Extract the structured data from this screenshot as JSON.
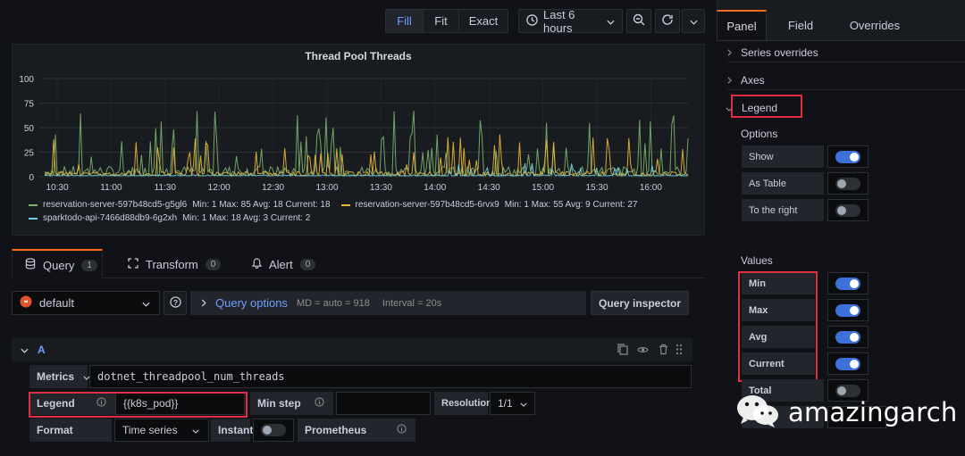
{
  "toolbar": {
    "fill": "Fill",
    "fit": "Fit",
    "exact": "Exact",
    "time_range": "Last 6 hours"
  },
  "chart_panel": {
    "title": "Thread Pool Threads"
  },
  "chart_data": {
    "type": "line",
    "title": "Thread Pool Threads",
    "ylim": [
      0,
      100
    ],
    "y_ticks": [
      "100",
      "75",
      "50",
      "25",
      "0"
    ],
    "x_ticks": [
      "10:30",
      "11:00",
      "11:30",
      "12:00",
      "12:30",
      "13:00",
      "13:30",
      "14:00",
      "14:30",
      "15:00",
      "15:30",
      "16:00"
    ],
    "grid": true,
    "legend_position": "bottom",
    "series": [
      {
        "name": "reservation-server-597b48cd5-g5gl6",
        "color": "#7eb26d",
        "stats": "Min: 1  Max: 85  Avg: 18  Current: 18"
      },
      {
        "name": "reservation-server-597b48cd5-6rvx9",
        "color": "#eab839",
        "stats": "Min: 1  Max: 55  Avg: 9  Current: 27"
      },
      {
        "name": "sparktodo-api-7466d88db9-6g2xh",
        "color": "#6ed0e0",
        "stats": "Min: 1  Max: 18  Avg: 3  Current: 2"
      }
    ]
  },
  "query_tabs": [
    {
      "label": "Query",
      "count": "1"
    },
    {
      "label": "Transform",
      "count": "0"
    },
    {
      "label": "Alert",
      "count": "0"
    }
  ],
  "datasource": {
    "name": "default",
    "query_options_label": "Query options",
    "md": "MD = auto = 918",
    "interval": "Interval = 20s",
    "inspector": "Query inspector"
  },
  "query_a": {
    "ref": "A",
    "metrics_label": "Metrics",
    "metrics_value": "dotnet_threadpool_num_threads",
    "legend_label": "Legend",
    "legend_value": "{{k8s_pod}}",
    "min_step_label": "Min step",
    "resolution_label": "Resolution",
    "resolution_value": "1/1",
    "format_label": "Format",
    "format_value": "Time series",
    "instant_label": "Instant",
    "prometheus_label": "Prometheus"
  },
  "side_panel": {
    "tabs": [
      "Panel",
      "Field",
      "Overrides"
    ],
    "sections": [
      "Series overrides",
      "Axes",
      "Legend"
    ],
    "options_title": "Options",
    "options": [
      {
        "label": "Show",
        "on": true
      },
      {
        "label": "As Table",
        "on": false
      },
      {
        "label": "To the right",
        "on": false
      }
    ],
    "values_title": "Values",
    "values": [
      {
        "label": "Min",
        "on": true
      },
      {
        "label": "Max",
        "on": true
      },
      {
        "label": "Avg",
        "on": true
      },
      {
        "label": "Current",
        "on": true
      },
      {
        "label": "Total",
        "on": false
      }
    ]
  },
  "watermark": {
    "text": "amazingarch"
  }
}
